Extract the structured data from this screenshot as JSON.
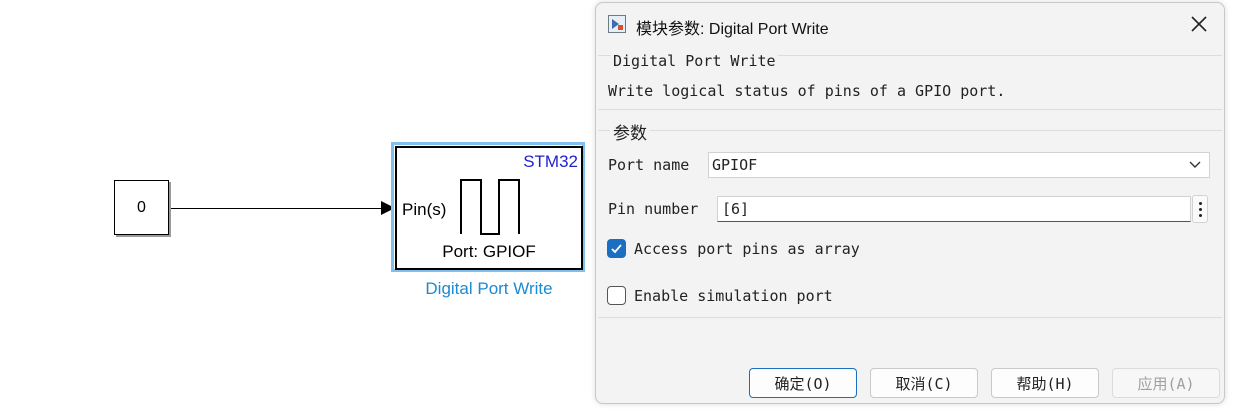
{
  "canvas": {
    "constant_value": "0",
    "block": {
      "vendor_label": "STM32",
      "input_label": "Pin(s)",
      "port_label": "Port: GPIOF",
      "name": "Digital Port Write"
    }
  },
  "dialog": {
    "title": "模块参数: Digital Port Write",
    "description_title": "Digital Port Write",
    "description_text": "Write logical status of pins of a GPIO port.",
    "params_title": "参数",
    "port_name_label": "Port name",
    "port_name_value": "GPIOF",
    "pin_number_label": "Pin number",
    "pin_number_value": "[6]",
    "access_array_label": "Access port pins as array",
    "access_array_checked": true,
    "enable_sim_label": "Enable simulation port",
    "enable_sim_checked": false,
    "buttons": {
      "ok": "确定(O)",
      "cancel": "取消(C)",
      "help": "帮助(H)",
      "apply": "应用(A)"
    }
  },
  "colors": {
    "accent": "#1a6fc2",
    "vendor_text": "#1f1fd0",
    "block_name": "#1a8ad4",
    "selection": "#7ec0ee"
  },
  "icons": [
    "simulink-block-icon",
    "close-icon",
    "chevron-down-icon",
    "kebab-menu-icon",
    "checkbox-checked-icon"
  ]
}
